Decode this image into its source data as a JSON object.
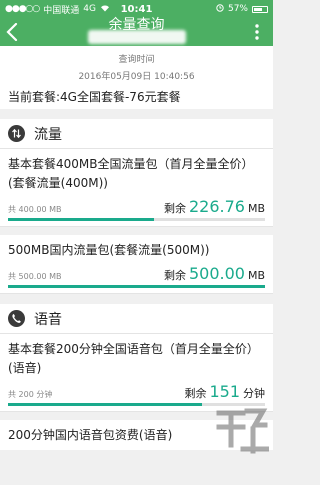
{
  "status_bar": {
    "carrier": "中国联通",
    "network": "4G",
    "time": "10:41",
    "battery": "57%"
  },
  "nav": {
    "title": "余量查询"
  },
  "query": {
    "label": "查询时间",
    "time": "2016年05月09日 10:40:56",
    "current_plan": "当前套餐:4G全国套餐-76元套餐"
  },
  "data_section": {
    "title": "流量",
    "items": [
      {
        "name": "基本套餐400MB全国流量包（首月全量全价）(套餐流量(400M))",
        "total": "共 400.00 MB",
        "remain_label": "剩余",
        "remain_value": "226.76",
        "remain_unit": "MB",
        "fraction": 0.567
      },
      {
        "name": "500MB国内流量包(套餐流量(500M))",
        "total": "共 500.00 MB",
        "remain_label": "剩余",
        "remain_value": "500.00",
        "remain_unit": "MB",
        "fraction": 1.0
      }
    ]
  },
  "voice_section": {
    "title": "语音",
    "items": [
      {
        "name": "基本套餐200分钟全国语音包（首月全量全价）(语音)",
        "total": "共 200 分钟",
        "remain_label": "剩余",
        "remain_value": "151",
        "remain_unit": "分钟",
        "fraction": 0.755
      },
      {
        "name": "200分钟国内语音包资费(语音)"
      }
    ]
  },
  "colors": {
    "header": "#4caf63",
    "accent": "#1aaa8c"
  }
}
